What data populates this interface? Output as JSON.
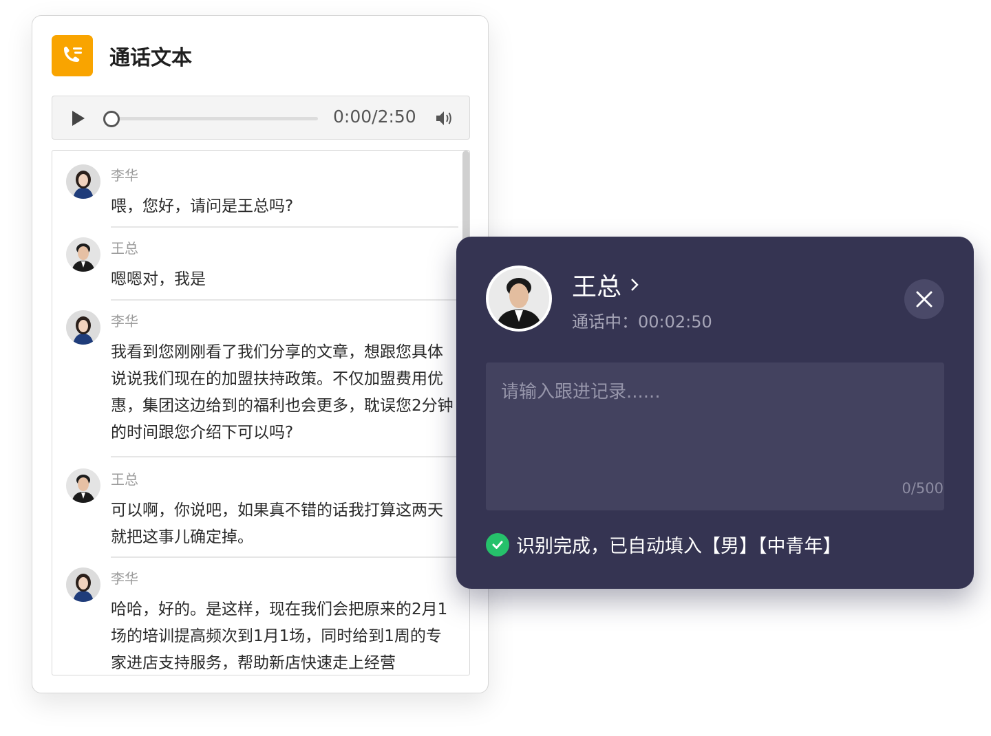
{
  "transcript": {
    "title": "通话文本",
    "player": {
      "time": "0:00/2:50",
      "progress": 0
    },
    "messages": [
      {
        "speaker": "李华",
        "text": "喂，您好，请问是王总吗?"
      },
      {
        "speaker": "王总",
        "text": "嗯嗯对，我是"
      },
      {
        "speaker": "李华",
        "text": "我看到您刚刚看了我们分享的文章，想跟您具体说说我们现在的加盟扶持政策。不仅加盟费用优惠，集团这边给到的福利也会更多，耽误您2分钟的时间跟您介绍下可以吗?"
      },
      {
        "speaker": "王总",
        "text": "可以啊，你说吧，如果真不错的话我打算这两天就把这事儿确定掉。"
      },
      {
        "speaker": "李华",
        "text": "哈哈，好的。是这样，现在我们会把原来的2月1场的培训提高频次到1月1场，同时给到1周的专家进店支持服务，帮助新店快速走上经营"
      }
    ]
  },
  "call": {
    "contact_name": "王总",
    "status": "通话中：00:02:50",
    "note_placeholder": "请输入跟进记录......",
    "char_counter": "0/500",
    "recognition": "识别完成，已自动填入【男】【中青年】"
  },
  "colors": {
    "accent_orange": "#f9a400",
    "panel_bg": "#353452",
    "success_green": "#26c16b"
  },
  "icons": [
    "phone-list-icon",
    "play-icon",
    "volume-icon",
    "chevron-right-icon",
    "close-icon",
    "check-icon"
  ]
}
